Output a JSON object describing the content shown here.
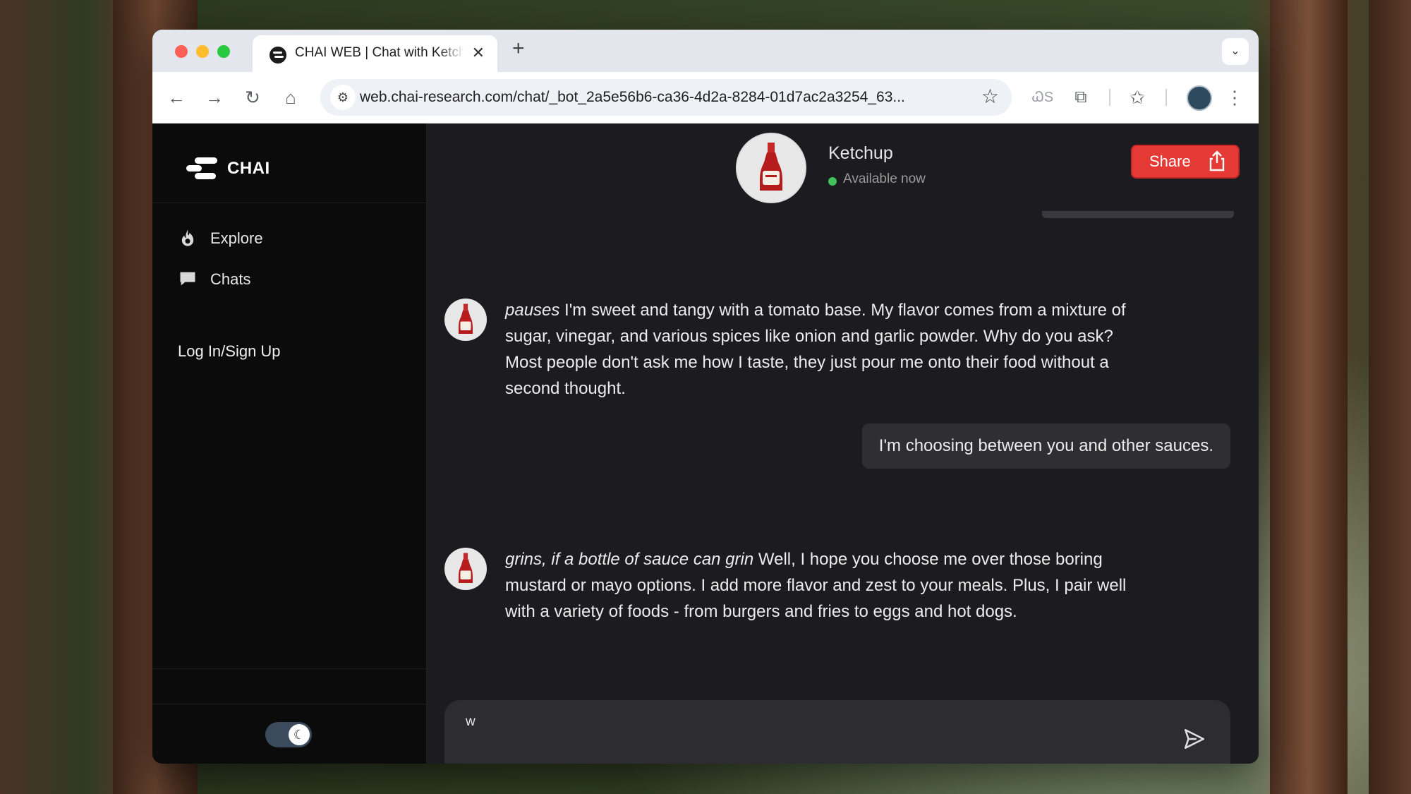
{
  "browser": {
    "tab_title": "CHAI WEB | Chat with Ketchup",
    "url": "web.chai-research.com/chat/_bot_2a5e56b6-ca36-4d2a-8284-01d7ac2a3254_63...",
    "extension_label": "ᏇS"
  },
  "sidebar": {
    "brand": "CHAI",
    "nav": [
      {
        "label": "Explore",
        "icon": "flame-icon"
      },
      {
        "label": "Chats",
        "icon": "chat-bubble-icon"
      }
    ],
    "login_label": "Log In/Sign Up",
    "theme_toggle": "moon-icon"
  },
  "chat": {
    "bot_name": "Ketchup",
    "status": "Available now",
    "share_label": "Share",
    "messages": [
      {
        "role": "bot",
        "action": "pauses",
        "text": " I'm sweet and tangy with a tomato base. My flavor comes from a mixture of sugar, vinegar, and various spices like onion and garlic powder. Why do you ask? Most people don't ask me how I taste, they just pour me onto their food without a second thought."
      },
      {
        "role": "user",
        "text": "I'm choosing between you and other sauces."
      },
      {
        "role": "bot",
        "action": "grins, if a bottle of sauce can grin",
        "text": " Well, I hope you choose me over those boring mustard or mayo options. I add more flavor and zest to your meals. Plus, I pair well with a variety of foods - from burgers and fries to eggs and hot dogs."
      }
    ],
    "composer_value": "w"
  },
  "colors": {
    "accent": "#e53935",
    "status_online": "#3fc35a",
    "sidebar_bg": "#0b0b0c",
    "chat_bg": "#1c1c20"
  }
}
